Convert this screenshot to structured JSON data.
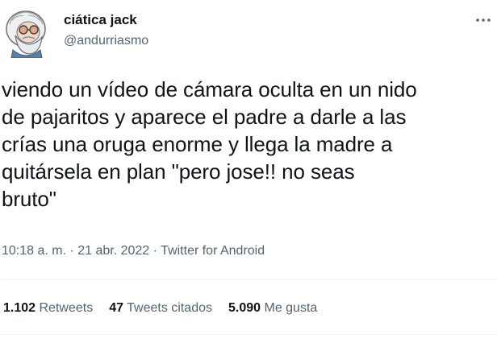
{
  "author": {
    "display_name": "ciática jack",
    "handle": "@andurriasmo",
    "avatar_icon": "old-man-glasses-avatar-icon"
  },
  "more_icon": "more-options-icon",
  "tweet": {
    "text": "viendo un vídeo de cámara oculta en un nido\nde pajaritos y aparece el padre a darle a las\ncrías una oruga enorme y llega la madre a\nquitársela en plan \"pero jose!! no seas\nbruto\""
  },
  "meta": {
    "time": "10:18 a. m.",
    "separator": " · ",
    "date": "21 abr. 2022",
    "source": "Twitter for Android"
  },
  "stats": {
    "retweets_count": "1.102",
    "retweets_label": "Retweets",
    "quotes_count": "47",
    "quotes_label": "Tweets citados",
    "likes_count": "5.090",
    "likes_label": "Me gusta"
  },
  "colors": {
    "text_primary": "#0f1419",
    "text_secondary": "#536471",
    "divider": "#eff3f4"
  }
}
